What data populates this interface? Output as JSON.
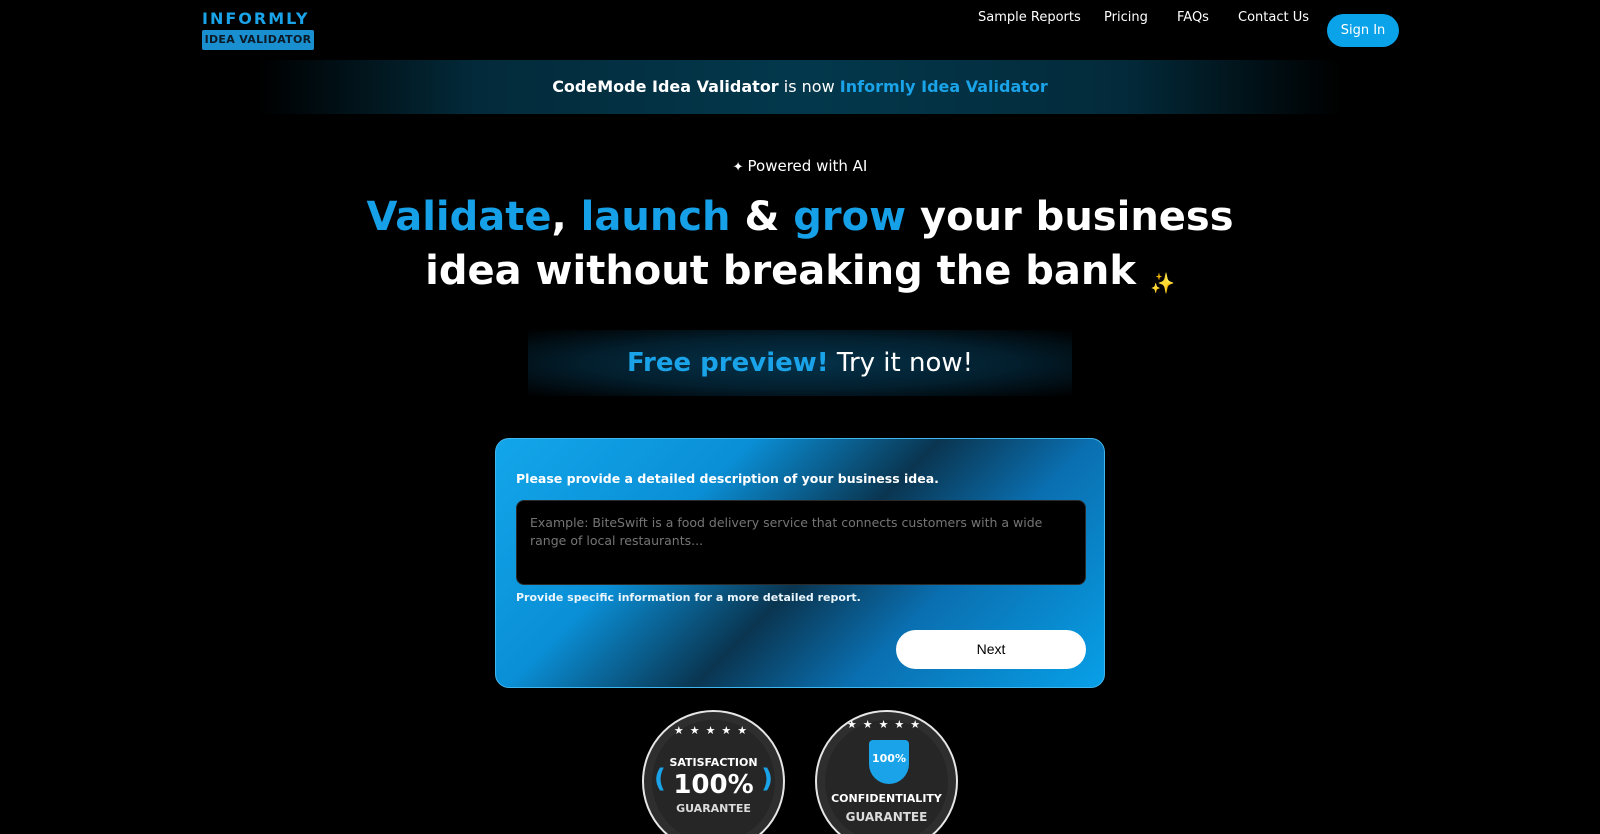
{
  "header": {
    "logo_top": "INFORMLY",
    "logo_bottom": "IDEA VALIDATOR",
    "nav": [
      "Sample Reports",
      "Pricing",
      "FAQs",
      "Contact Us"
    ],
    "sign_in": "Sign In"
  },
  "banner": {
    "old_name": "CodeMode Idea Validator",
    "middle": "is now",
    "new_name": "Informly Idea Validator"
  },
  "powered": "Powered with AI",
  "headline": {
    "w1": "Validate",
    "c1": ",",
    "w2": "launch",
    "amp": "&",
    "w3": "grow",
    "rest1": "your business",
    "rest2": "idea without breaking the bank"
  },
  "preview": {
    "blue": "Free preview!",
    "white": "Try it now!"
  },
  "form": {
    "label": "Please provide a detailed description of your business idea.",
    "placeholder": "Example: BiteSwift is a food delivery service that connects customers with a wide range of local restaurants...",
    "hint": "Provide specific information for a more detailed report.",
    "next": "Next"
  },
  "badges": {
    "satisfaction": {
      "top": "SATISFACTION",
      "big": "100%",
      "bottom": "GUARANTEE"
    },
    "confidentiality": {
      "shield": "100%",
      "top": "CONFIDENTIALITY",
      "bottom": "GUARANTEE"
    }
  },
  "colors": {
    "accent": "#1aa3e8",
    "background": "#000000"
  }
}
